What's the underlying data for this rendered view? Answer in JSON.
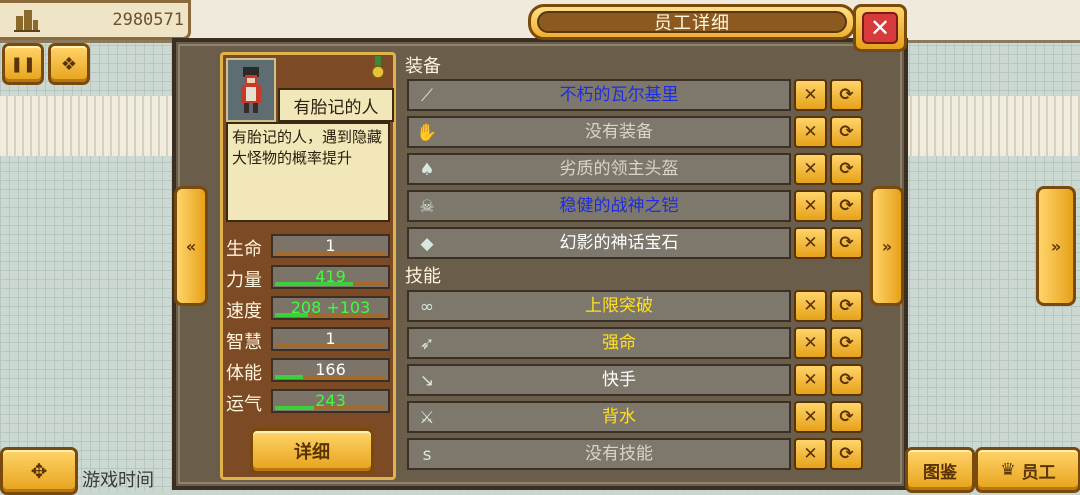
{
  "money": {
    "value": "2980571",
    "icon": "building-icon"
  },
  "window_title": "员工详细",
  "close_label": "✕",
  "top_left_buttons": [
    {
      "name": "pause-icon",
      "glyph": "❚❚"
    },
    {
      "name": "speed-icon",
      "glyph": "❖"
    }
  ],
  "employee": {
    "name": "有胎记的人",
    "description": "有胎记的人，遇到隐藏大怪物的概率提升"
  },
  "stats": [
    {
      "label": "生命",
      "value": "1",
      "fill": 0.0,
      "color": "#ffffff"
    },
    {
      "label": "力量",
      "value": "419",
      "fill": 0.7,
      "color": "#3cff3c"
    },
    {
      "label": "速度",
      "value": "208 +103",
      "fill": 0.3,
      "color": "#3cff3c"
    },
    {
      "label": "智慧",
      "value": "1",
      "fill": 0.0,
      "color": "#ffffff"
    },
    {
      "label": "体能",
      "value": "166",
      "fill": 0.25,
      "color": "#ffffff"
    },
    {
      "label": "运气",
      "value": "243",
      "fill": 0.35,
      "color": "#3cff3c"
    }
  ],
  "detail_button": "详细",
  "equipment_title": "装备",
  "equipment": [
    {
      "label": "不朽的瓦尔基里",
      "color": "#1c2ee0",
      "icon": "spear-icon",
      "glyph": "⟋"
    },
    {
      "label": "没有装备",
      "color": "#d8d4c8",
      "icon": "glove-icon",
      "glyph": "✋"
    },
    {
      "label": "劣质的领主头盔",
      "color": "#d8d4c8",
      "icon": "helmet-icon",
      "glyph": "♠"
    },
    {
      "label": "稳健的战神之铠",
      "color": "#1c2ee0",
      "icon": "armor-icon",
      "glyph": "☠"
    },
    {
      "label": "幻影的神话宝石",
      "color": "#ffffff",
      "icon": "gem-icon",
      "glyph": "◆"
    }
  ],
  "skills_title": "技能",
  "skills": [
    {
      "label": "上限突破",
      "color": "#ffe020",
      "icon": "chain-icon",
      "glyph": "∞"
    },
    {
      "label": "强命",
      "color": "#ffe020",
      "icon": "wing-icon",
      "glyph": "➶"
    },
    {
      "label": "快手",
      "color": "#ffffff",
      "icon": "dagger-icon",
      "glyph": "↘"
    },
    {
      "label": "背水",
      "color": "#ffe020",
      "icon": "sword-icon",
      "glyph": "⚔"
    },
    {
      "label": "没有技能",
      "color": "#d8d4c8",
      "icon": "empty-slot-icon",
      "glyph": "s"
    }
  ],
  "bottom_left_label": "游戏时间",
  "bottom_right_buttons": [
    {
      "label": "图鉴",
      "icon": ""
    },
    {
      "label": "员工",
      "icon": "crown-icon"
    }
  ]
}
